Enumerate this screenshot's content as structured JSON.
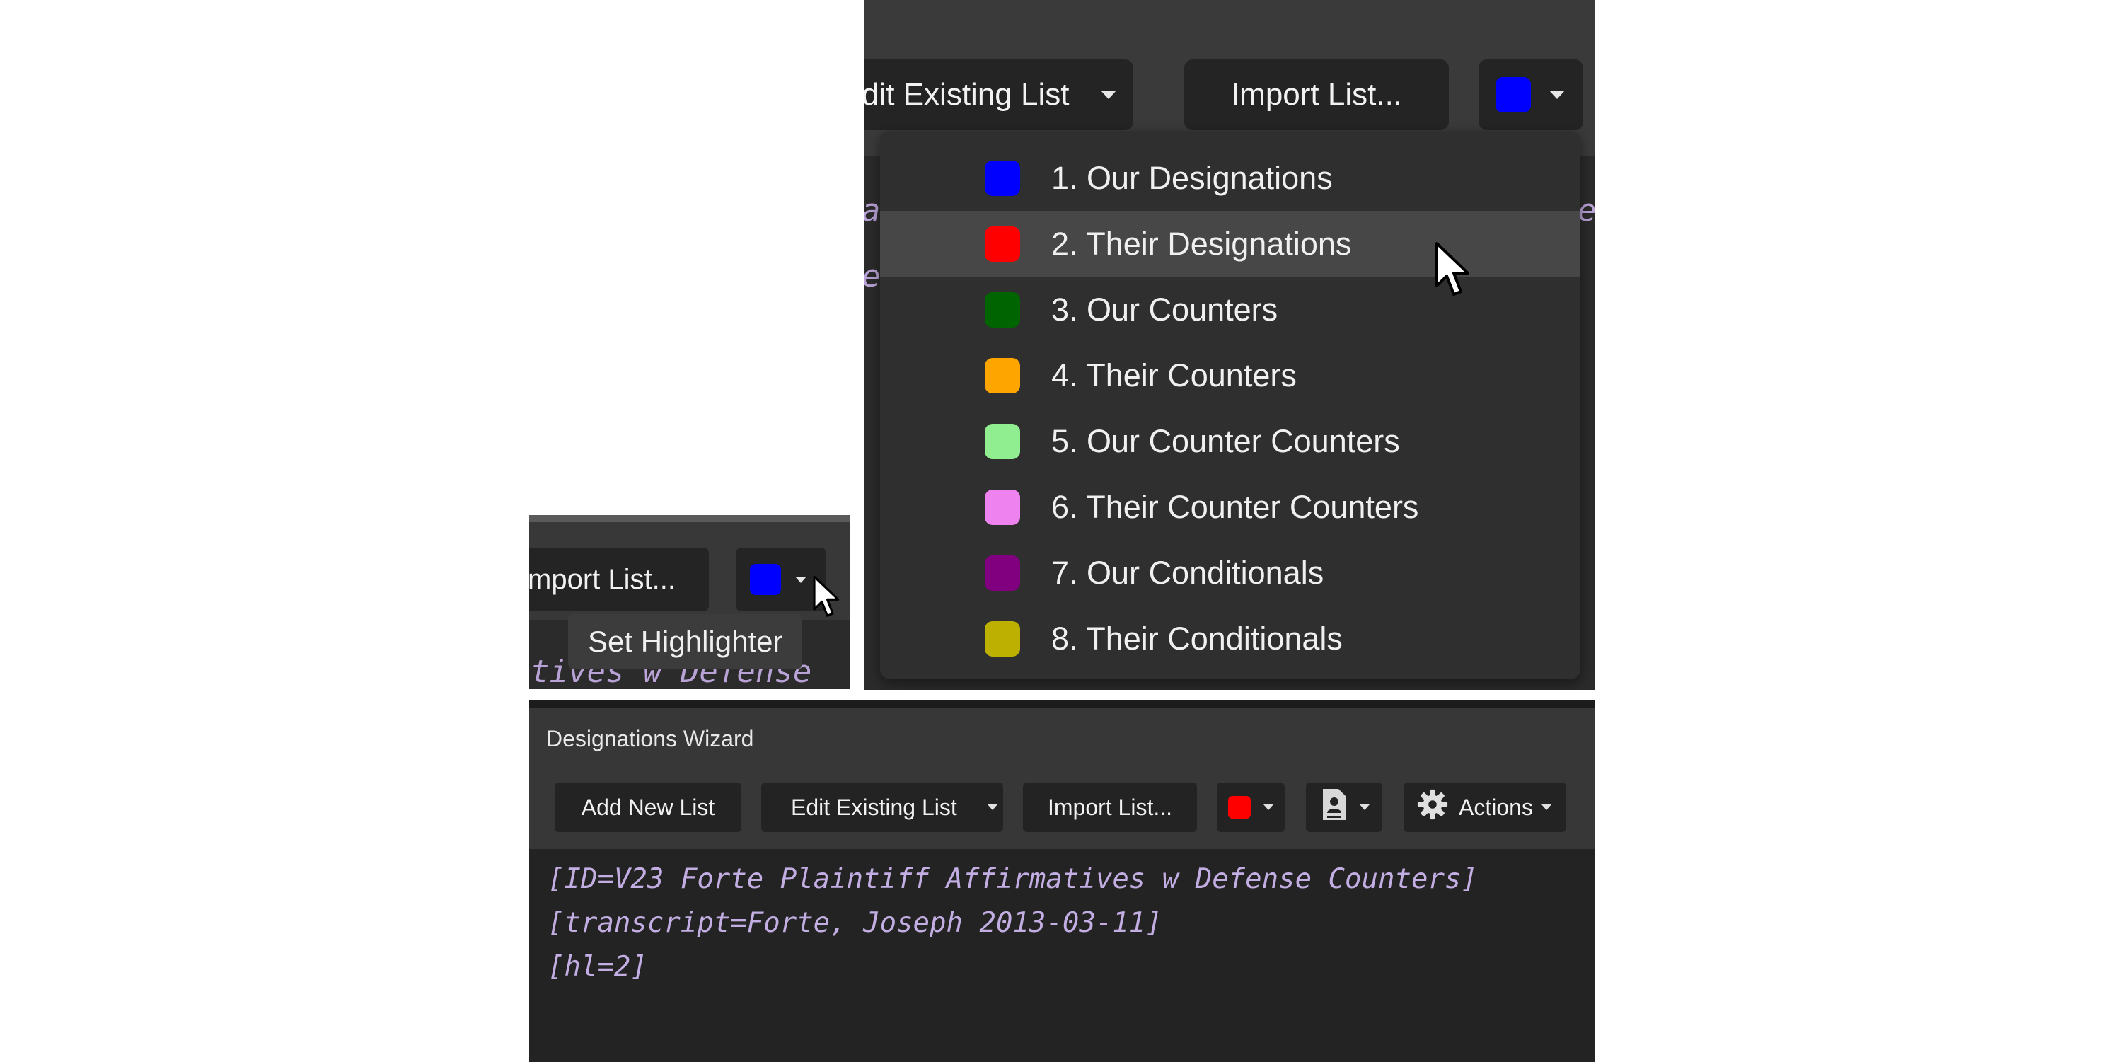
{
  "zoom_menu": {
    "toolbar": {
      "edit_existing_partial": "dit Existing List",
      "import_list": "Import List...",
      "highlighter_color": "#0000ff"
    },
    "menu_items": [
      {
        "label": "1. Our Designations",
        "color": "#0000ff"
      },
      {
        "label": "2. Their Designations",
        "color": "#ff0000",
        "hovered": true
      },
      {
        "label": "3. Our Counters",
        "color": "#006400"
      },
      {
        "label": "4. Their Counters",
        "color": "#ffa500"
      },
      {
        "label": "5. Our Counter Counters",
        "color": "#90ee90"
      },
      {
        "label": "6. Their Counter Counters",
        "color": "#ee82ee"
      },
      {
        "label": "7. Our Conditionals",
        "color": "#800080"
      },
      {
        "label": "8. Their Conditionals",
        "color": "#bdb000"
      }
    ]
  },
  "zoom_tooltip": {
    "import_partial": "mport List...",
    "highlighter_color": "#0000ff",
    "tooltip": "Set Highlighter",
    "editor_partial": "tives w Defense"
  },
  "window": {
    "title": "Designations Wizard",
    "toolbar": {
      "add_new_list": "Add New List",
      "edit_existing_list": "Edit Existing List",
      "import_list": "Import List...",
      "highlighter_color": "#ff0000",
      "actions": "Actions"
    },
    "editor_lines": [
      "[ID=V23 Forte Plaintiff Affirmatives w Defense Counters]",
      "[transcript=Forte, Joseph 2013-03-11]",
      "[hl=2]"
    ]
  },
  "icons": {
    "dropdown": "chevron-down-icon",
    "document": "document-icon",
    "gear": "gear-icon",
    "cursor": "mouse-pointer-icon"
  }
}
